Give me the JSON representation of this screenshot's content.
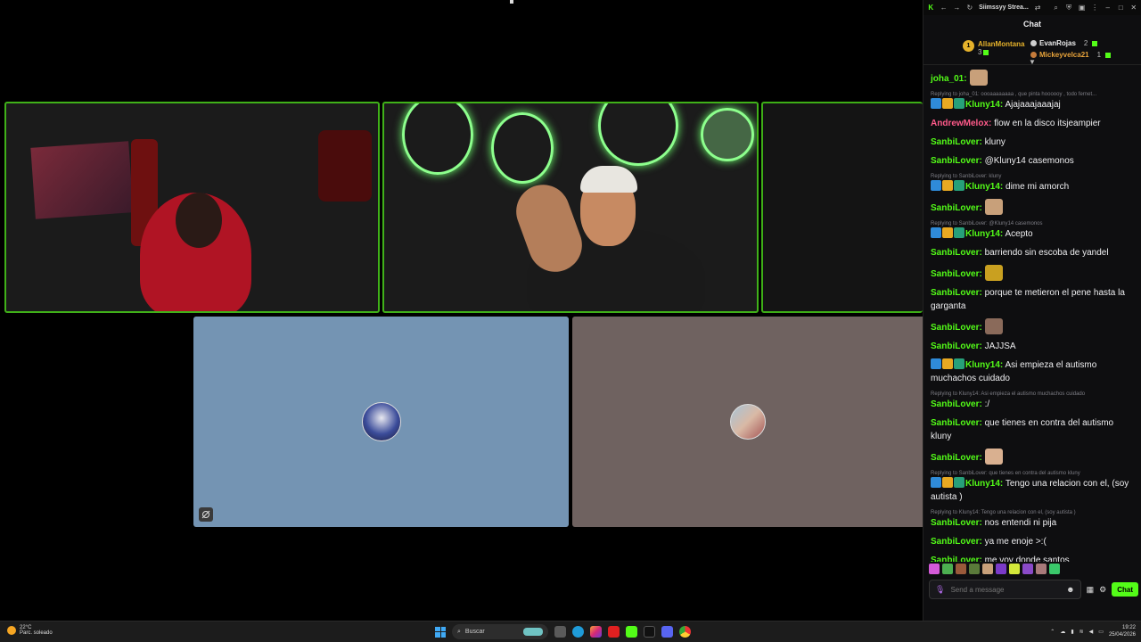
{
  "browser": {
    "tab_title": "Siimssyy Strea..."
  },
  "chat": {
    "header": "Chat",
    "leaderboard": [
      {
        "rank": "1",
        "name": "AllanMontana",
        "count": "3"
      },
      {
        "rank": "2",
        "name": "EvanRojas",
        "count": "2"
      },
      {
        "rank": "3",
        "name": "Mickeyvelca21",
        "count": "1"
      }
    ],
    "messages": [
      {
        "reply": "",
        "user": "joha_01:",
        "text": "",
        "style": "u-green",
        "badges": false,
        "emote": true
      },
      {
        "reply": "Replying to joha_01: oooaaaaaaaa , que pinta hoooooy , todo fernet...",
        "user": "Kluny14:",
        "text": " Ajajaaajaaajaj",
        "style": "u-kluny",
        "badges": true,
        "emote": false
      },
      {
        "reply": "",
        "user": "AndrewMelox:",
        "text": " flow en la disco itsjeampier",
        "style": "u-pink",
        "badges": false,
        "emote": false
      },
      {
        "reply": "",
        "user": "SanbiLover:",
        "text": " kluny",
        "style": "u-green",
        "badges": false,
        "emote": false
      },
      {
        "reply": "",
        "user": "SanbiLover:",
        "text": " @Kluny14 casemonos",
        "style": "u-green",
        "badges": false,
        "emote": false
      },
      {
        "reply": "Replying to SanbiLover: kluny",
        "user": "Kluny14:",
        "text": " dime mi amorch",
        "style": "u-kluny",
        "badges": true,
        "emote": false
      },
      {
        "reply": "",
        "user": "SanbiLover:",
        "text": "",
        "style": "u-green",
        "badges": false,
        "emote": true
      },
      {
        "reply": "Replying to SanbiLover: @Kluny14 casemonos",
        "user": "Kluny14:",
        "text": " Acepto",
        "style": "u-kluny",
        "badges": true,
        "emote": false
      },
      {
        "reply": "",
        "user": "SanbiLover:",
        "text": " barriendo sin escoba de yandel",
        "style": "u-green",
        "badges": false,
        "emote": false
      },
      {
        "reply": "",
        "user": "SanbiLover:",
        "text": "",
        "style": "u-green",
        "badges": false,
        "emote": true
      },
      {
        "reply": "",
        "user": "SanbiLover:",
        "text": " porque te metieron el pene hasta la garganta",
        "style": "u-green",
        "badges": false,
        "emote": false
      },
      {
        "reply": "",
        "user": "SanbiLover:",
        "text": "",
        "style": "u-green",
        "badges": false,
        "emote": true
      },
      {
        "reply": "",
        "user": "SanbiLover:",
        "text": " JAJJSA",
        "style": "u-green",
        "badges": false,
        "emote": false
      },
      {
        "reply": "",
        "user": "Kluny14:",
        "text": " Asi empieza el autismo muchachos cuidado",
        "style": "u-kluny",
        "badges": true,
        "emote": false
      },
      {
        "reply": "Replying to Kluny14: Asi empieza el autismo muchachos cuidado",
        "user": "SanbiLover:",
        "text": " :/",
        "style": "u-green",
        "badges": false,
        "emote": false
      },
      {
        "reply": "",
        "user": "SanbiLover:",
        "text": " que tienes en contra del autismo kluny",
        "style": "u-green",
        "badges": false,
        "emote": false
      },
      {
        "reply": "",
        "user": "SanbiLover:",
        "text": "",
        "style": "u-green",
        "badges": false,
        "emote": true
      },
      {
        "reply": "Replying to SanbiLover: que tienes en contra del autismo kluny",
        "user": "Kluny14:",
        "text": " Tengo una relacion con el, (soy autista )",
        "style": "u-kluny",
        "badges": true,
        "emote": false
      },
      {
        "reply": "Replying to Kluny14: Tengo una relacion con el, (soy autista )",
        "user": "SanbiLover:",
        "text": " nos entendi ni pija",
        "style": "u-green",
        "badges": false,
        "emote": false
      },
      {
        "reply": "",
        "user": "SanbiLover:",
        "text": " ya me enoje >:(",
        "style": "u-green",
        "badges": false,
        "emote": false
      },
      {
        "reply": "",
        "user": "SanbiLover:",
        "text": " me voy donde santos",
        "style": "u-green",
        "badges": false,
        "emote": false
      }
    ],
    "input_placeholder": "Send a message",
    "send_label": "Chat"
  },
  "taskbar": {
    "temperature": "22°C",
    "weather_desc": "Parc. soleado",
    "search_label": "Buscar",
    "time": "19:22",
    "date": "25/04/2026"
  },
  "colors": {
    "kick_green": "#53fc18",
    "chat_bg": "#0e0e10",
    "tile_blue": "#7494b3",
    "tile_mauve": "#6f6260"
  }
}
